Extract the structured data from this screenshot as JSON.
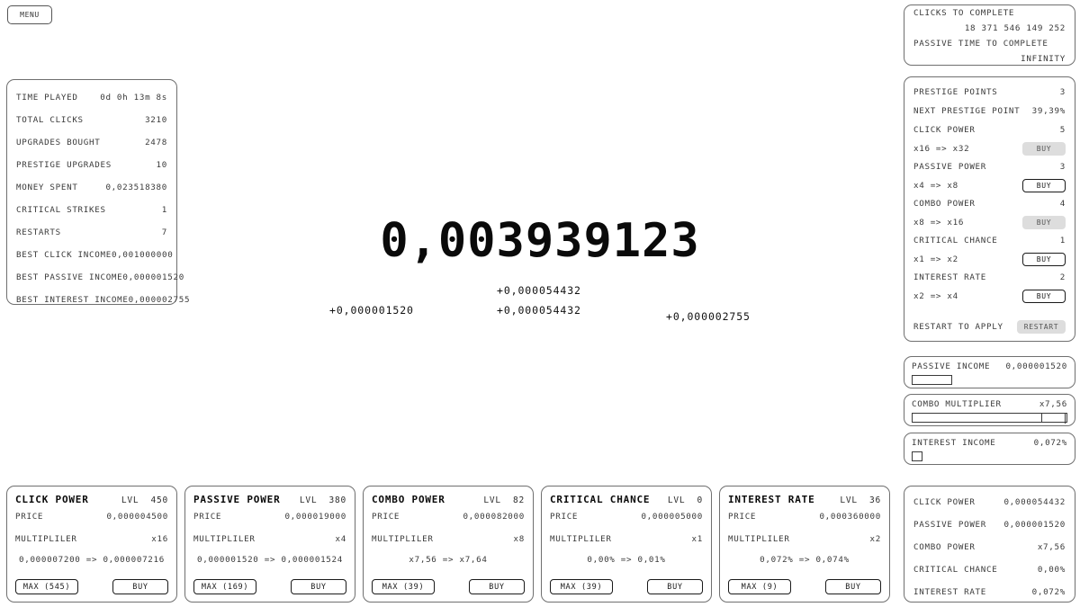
{
  "menu": {
    "label": "MENU"
  },
  "clicker": {
    "money": "0,003939123",
    "floats": [
      "+0,000001520",
      "+0,000054432",
      "+0,000054432",
      "+0,000002755"
    ]
  },
  "stats": {
    "rows": [
      {
        "key": "TIME PLAYED",
        "value": "0d 0h 13m 8s"
      },
      {
        "key": "TOTAL CLICKS",
        "value": "3210"
      },
      {
        "key": "UPGRADES BOUGHT",
        "value": "2478"
      },
      {
        "key": "PRESTIGE UPGRADES",
        "value": "10"
      },
      {
        "key": "MONEY SPENT",
        "value": "0,023518380"
      },
      {
        "key": "CRITICAL STRIKES",
        "value": "1"
      },
      {
        "key": "RESTARTS",
        "value": "7"
      },
      {
        "key": "BEST CLICK INCOME",
        "value": "0,001000000"
      },
      {
        "key": "BEST PASSIVE INCOME",
        "value": "0,000001520"
      },
      {
        "key": "BEST INTEREST INCOME",
        "value": "0,000002755"
      }
    ]
  },
  "completion": {
    "clicks_label": "CLICKS TO COMPLETE",
    "clicks_value": "18 371 546 149 252",
    "passive_label": "PASSIVE TIME TO COMPLETE",
    "passive_value": "INFINITY"
  },
  "prestige": {
    "points_label": "PRESTIGE POINTS",
    "points_value": "3",
    "next_label": "NEXT PRESTIGE POINT",
    "next_value": "39,39%",
    "upgrades": [
      {
        "name": "CLICK POWER",
        "level": "5",
        "from_to": "x16 => x32",
        "buy": "BUY",
        "enabled": false
      },
      {
        "name": "PASSIVE POWER",
        "level": "3",
        "from_to": "x4 => x8",
        "buy": "BUY",
        "enabled": true
      },
      {
        "name": "COMBO POWER",
        "level": "4",
        "from_to": "x8 => x16",
        "buy": "BUY",
        "enabled": false
      },
      {
        "name": "CRITICAL CHANCE",
        "level": "1",
        "from_to": "x1 => x2",
        "buy": "BUY",
        "enabled": true
      },
      {
        "name": "INTEREST RATE",
        "level": "2",
        "from_to": "x2 => x4",
        "buy": "BUY",
        "enabled": true
      }
    ],
    "restart_label": "RESTART TO APPLY",
    "restart_button": "RESTART"
  },
  "meters": [
    {
      "label": "PASSIVE INCOME",
      "value": "0,000001520",
      "percent": 26,
      "style": "fill"
    },
    {
      "label": "COMBO MULTIPLIER",
      "value": "x7,56",
      "percent": 84,
      "style": "track"
    },
    {
      "label": "INTEREST INCOME",
      "value": "0,072%",
      "percent": 7,
      "style": "fill"
    }
  ],
  "summary": {
    "rows": [
      {
        "key": "CLICK POWER",
        "value": "0,000054432"
      },
      {
        "key": "PASSIVE POWER",
        "value": "0,000001520"
      },
      {
        "key": "COMBO POWER",
        "value": "x7,56"
      },
      {
        "key": "CRITICAL CHANCE",
        "value": "0,00%"
      },
      {
        "key": "INTEREST RATE",
        "value": "0,072%"
      }
    ]
  },
  "upgrade_cards": [
    {
      "title": "CLICK POWER",
      "lvl_label": "LVL",
      "lvl_value": "450",
      "price_label": "PRICE",
      "price_value": "0,000004500",
      "mult_label": "MULTIPLILER",
      "mult_value": "x16",
      "progress": "0,000007200 => 0,000007216",
      "max_label": "MAX (545)",
      "buy_label": "BUY"
    },
    {
      "title": "PASSIVE POWER",
      "lvl_label": "LVL",
      "lvl_value": "380",
      "price_label": "PRICE",
      "price_value": "0,000019000",
      "mult_label": "MULTIPLILER",
      "mult_value": "x4",
      "progress": "0,000001520 => 0,000001524",
      "max_label": "MAX (169)",
      "buy_label": "BUY"
    },
    {
      "title": "COMBO POWER",
      "lvl_label": "LVL",
      "lvl_value": "82",
      "price_label": "PRICE",
      "price_value": "0,000082000",
      "mult_label": "MULTIPLILER",
      "mult_value": "x8",
      "progress": "x7,56 => x7,64",
      "max_label": "MAX (39)",
      "buy_label": "BUY"
    },
    {
      "title": "CRITICAL CHANCE",
      "lvl_label": "LVL",
      "lvl_value": "0",
      "price_label": "PRICE",
      "price_value": "0,000005000",
      "mult_label": "MULTIPLILER",
      "mult_value": "x1",
      "progress": "0,00% => 0,01%",
      "max_label": "MAX (39)",
      "buy_label": "BUY"
    },
    {
      "title": "INTEREST RATE",
      "lvl_label": "LVL",
      "lvl_value": "36",
      "price_label": "PRICE",
      "price_value": "0,000360000",
      "mult_label": "MULTIPLILER",
      "mult_value": "x2",
      "progress": "0,072% => 0,074%",
      "max_label": "MAX (9)",
      "buy_label": "BUY"
    }
  ],
  "colors": {
    "panel_border": "#6f6f6f",
    "text": "#3a3a3a",
    "disabled_button_bg": "#dddddd",
    "background": "#ffffff"
  }
}
